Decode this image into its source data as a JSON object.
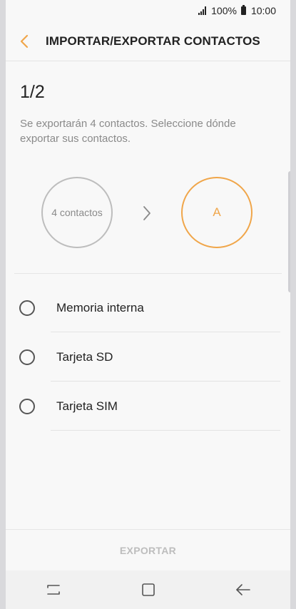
{
  "status_bar": {
    "battery_percent": "100%",
    "time": "10:00",
    "icons": [
      "signal-icon",
      "battery-icon"
    ]
  },
  "header": {
    "title": "IMPORTAR/EXPORTAR CONTACTOS",
    "back_icon": "chevron-left-icon"
  },
  "main": {
    "step": "1/2",
    "description": "Se exportarán 4 contactos. Seleccione dónde exportar sus contactos.",
    "source_label": "4 contactos",
    "destination_label": "A",
    "arrow_icon": "chevron-right-icon"
  },
  "options": [
    {
      "label": "Memoria interna",
      "selected": false
    },
    {
      "label": "Tarjeta SD",
      "selected": false
    },
    {
      "label": "Tarjeta SIM",
      "selected": false
    }
  ],
  "footer": {
    "export_label": "EXPORTAR",
    "enabled": false
  },
  "nav_bar": {
    "icons": [
      "recent-apps-icon",
      "home-icon",
      "back-arrow-icon"
    ]
  },
  "colors": {
    "accent": "#f0a64a",
    "disabled": "#bdbdbd",
    "text": "#222222",
    "secondary_text": "#8a8a8a"
  }
}
